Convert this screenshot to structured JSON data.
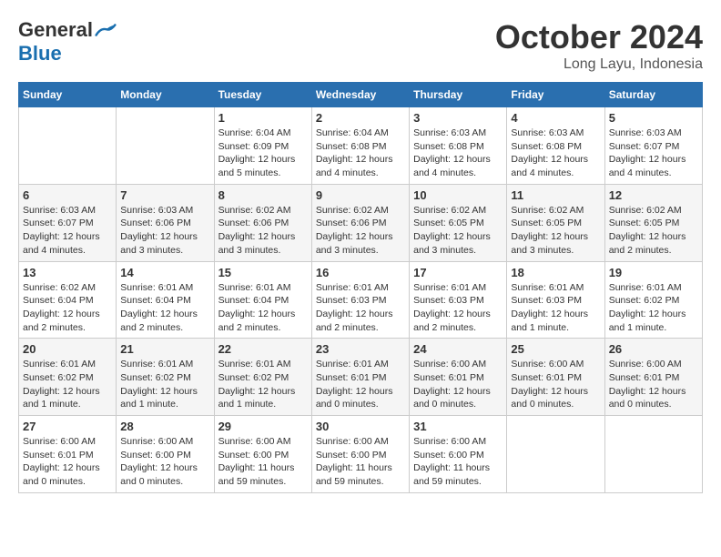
{
  "logo": {
    "general": "General",
    "blue": "Blue"
  },
  "title": "October 2024",
  "location": "Long Layu, Indonesia",
  "days_header": [
    "Sunday",
    "Monday",
    "Tuesday",
    "Wednesday",
    "Thursday",
    "Friday",
    "Saturday"
  ],
  "weeks": [
    [
      {
        "day": "",
        "info": ""
      },
      {
        "day": "",
        "info": ""
      },
      {
        "day": "1",
        "info": "Sunrise: 6:04 AM\nSunset: 6:09 PM\nDaylight: 12 hours and 5 minutes."
      },
      {
        "day": "2",
        "info": "Sunrise: 6:04 AM\nSunset: 6:08 PM\nDaylight: 12 hours and 4 minutes."
      },
      {
        "day": "3",
        "info": "Sunrise: 6:03 AM\nSunset: 6:08 PM\nDaylight: 12 hours and 4 minutes."
      },
      {
        "day": "4",
        "info": "Sunrise: 6:03 AM\nSunset: 6:08 PM\nDaylight: 12 hours and 4 minutes."
      },
      {
        "day": "5",
        "info": "Sunrise: 6:03 AM\nSunset: 6:07 PM\nDaylight: 12 hours and 4 minutes."
      }
    ],
    [
      {
        "day": "6",
        "info": "Sunrise: 6:03 AM\nSunset: 6:07 PM\nDaylight: 12 hours and 4 minutes."
      },
      {
        "day": "7",
        "info": "Sunrise: 6:03 AM\nSunset: 6:06 PM\nDaylight: 12 hours and 3 minutes."
      },
      {
        "day": "8",
        "info": "Sunrise: 6:02 AM\nSunset: 6:06 PM\nDaylight: 12 hours and 3 minutes."
      },
      {
        "day": "9",
        "info": "Sunrise: 6:02 AM\nSunset: 6:06 PM\nDaylight: 12 hours and 3 minutes."
      },
      {
        "day": "10",
        "info": "Sunrise: 6:02 AM\nSunset: 6:05 PM\nDaylight: 12 hours and 3 minutes."
      },
      {
        "day": "11",
        "info": "Sunrise: 6:02 AM\nSunset: 6:05 PM\nDaylight: 12 hours and 3 minutes."
      },
      {
        "day": "12",
        "info": "Sunrise: 6:02 AM\nSunset: 6:05 PM\nDaylight: 12 hours and 2 minutes."
      }
    ],
    [
      {
        "day": "13",
        "info": "Sunrise: 6:02 AM\nSunset: 6:04 PM\nDaylight: 12 hours and 2 minutes."
      },
      {
        "day": "14",
        "info": "Sunrise: 6:01 AM\nSunset: 6:04 PM\nDaylight: 12 hours and 2 minutes."
      },
      {
        "day": "15",
        "info": "Sunrise: 6:01 AM\nSunset: 6:04 PM\nDaylight: 12 hours and 2 minutes."
      },
      {
        "day": "16",
        "info": "Sunrise: 6:01 AM\nSunset: 6:03 PM\nDaylight: 12 hours and 2 minutes."
      },
      {
        "day": "17",
        "info": "Sunrise: 6:01 AM\nSunset: 6:03 PM\nDaylight: 12 hours and 2 minutes."
      },
      {
        "day": "18",
        "info": "Sunrise: 6:01 AM\nSunset: 6:03 PM\nDaylight: 12 hours and 1 minute."
      },
      {
        "day": "19",
        "info": "Sunrise: 6:01 AM\nSunset: 6:02 PM\nDaylight: 12 hours and 1 minute."
      }
    ],
    [
      {
        "day": "20",
        "info": "Sunrise: 6:01 AM\nSunset: 6:02 PM\nDaylight: 12 hours and 1 minute."
      },
      {
        "day": "21",
        "info": "Sunrise: 6:01 AM\nSunset: 6:02 PM\nDaylight: 12 hours and 1 minute."
      },
      {
        "day": "22",
        "info": "Sunrise: 6:01 AM\nSunset: 6:02 PM\nDaylight: 12 hours and 1 minute."
      },
      {
        "day": "23",
        "info": "Sunrise: 6:01 AM\nSunset: 6:01 PM\nDaylight: 12 hours and 0 minutes."
      },
      {
        "day": "24",
        "info": "Sunrise: 6:00 AM\nSunset: 6:01 PM\nDaylight: 12 hours and 0 minutes."
      },
      {
        "day": "25",
        "info": "Sunrise: 6:00 AM\nSunset: 6:01 PM\nDaylight: 12 hours and 0 minutes."
      },
      {
        "day": "26",
        "info": "Sunrise: 6:00 AM\nSunset: 6:01 PM\nDaylight: 12 hours and 0 minutes."
      }
    ],
    [
      {
        "day": "27",
        "info": "Sunrise: 6:00 AM\nSunset: 6:01 PM\nDaylight: 12 hours and 0 minutes."
      },
      {
        "day": "28",
        "info": "Sunrise: 6:00 AM\nSunset: 6:00 PM\nDaylight: 12 hours and 0 minutes."
      },
      {
        "day": "29",
        "info": "Sunrise: 6:00 AM\nSunset: 6:00 PM\nDaylight: 11 hours and 59 minutes."
      },
      {
        "day": "30",
        "info": "Sunrise: 6:00 AM\nSunset: 6:00 PM\nDaylight: 11 hours and 59 minutes."
      },
      {
        "day": "31",
        "info": "Sunrise: 6:00 AM\nSunset: 6:00 PM\nDaylight: 11 hours and 59 minutes."
      },
      {
        "day": "",
        "info": ""
      },
      {
        "day": "",
        "info": ""
      }
    ]
  ]
}
